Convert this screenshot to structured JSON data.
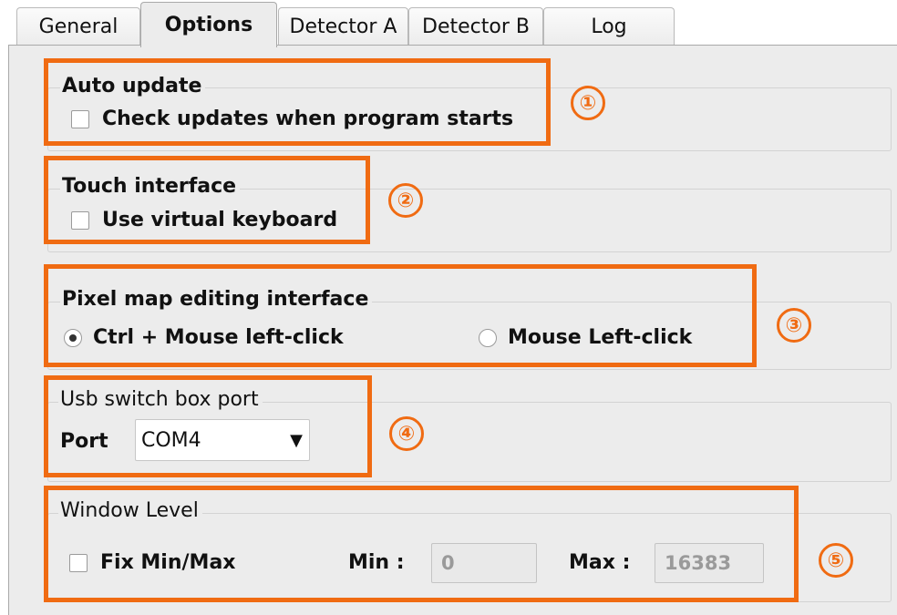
{
  "tabs": [
    {
      "label": "General"
    },
    {
      "label": "Options",
      "active": true
    },
    {
      "label": "Detector A"
    },
    {
      "label": "Detector B"
    },
    {
      "label": "Log"
    }
  ],
  "auto_update": {
    "title": "Auto update",
    "checkbox_label": "Check updates when program starts",
    "checked": false
  },
  "touch_interface": {
    "title": "Touch interface",
    "checkbox_label": "Use virtual keyboard",
    "checked": false
  },
  "pixel_map": {
    "title": "Pixel map editing interface",
    "options": [
      {
        "label": "Ctrl + Mouse left-click",
        "selected": true
      },
      {
        "label": "Mouse Left-click",
        "selected": false
      }
    ]
  },
  "usb_switch": {
    "title": "Usb switch box port",
    "port_label": "Port",
    "port_value": "COM4",
    "dropdown_arrow": "▼"
  },
  "window_level": {
    "title": "Window Level",
    "fix_label": "Fix Min/Max",
    "checked": false,
    "min_label": "Min :",
    "min_value": "0",
    "max_label": "Max :",
    "max_value": "16383"
  },
  "annotations": [
    "①",
    "②",
    "③",
    "④",
    "⑤"
  ],
  "colors": {
    "highlight": "#f06b12",
    "panel_bg": "#ececec"
  }
}
